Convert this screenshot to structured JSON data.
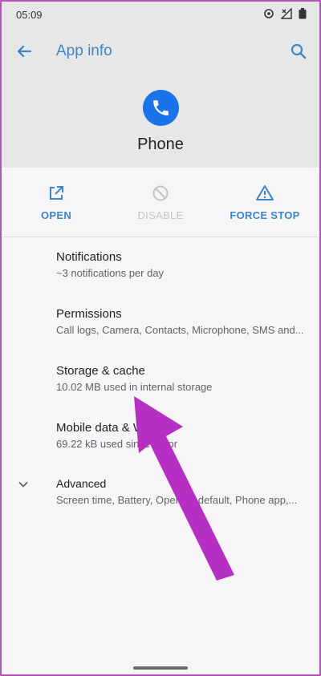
{
  "status_bar": {
    "time": "05:09",
    "icons": [
      "sync-icon",
      "no-signal-icon",
      "battery-icon"
    ]
  },
  "app_bar": {
    "title": "App info",
    "back_icon": "arrow-back-icon",
    "search_icon": "search-icon"
  },
  "app": {
    "name": "Phone",
    "icon": "phone-app-icon",
    "icon_color": "#1a73e8"
  },
  "actions": [
    {
      "label": "OPEN",
      "icon": "open-external-icon",
      "enabled": true
    },
    {
      "label": "DISABLE",
      "icon": "disable-icon",
      "enabled": false
    },
    {
      "label": "FORCE STOP",
      "icon": "warning-icon",
      "enabled": true
    }
  ],
  "settings": [
    {
      "title": "Notifications",
      "subtitle": "~3 notifications per day"
    },
    {
      "title": "Permissions",
      "subtitle": "Call logs, Camera, Contacts, Microphone, SMS and..."
    },
    {
      "title": "Storage & cache",
      "subtitle": "10.02 MB used in internal storage"
    },
    {
      "title": "Mobile data & Wi‑Fi",
      "subtitle": "69.22 kB used since 2 Apr"
    },
    {
      "title": "Advanced",
      "subtitle": "Screen time, Battery, Open by default, Phone app,..."
    }
  ],
  "colors": {
    "accent": "#3a86c8",
    "annotation_arrow": "#b52fc3"
  }
}
